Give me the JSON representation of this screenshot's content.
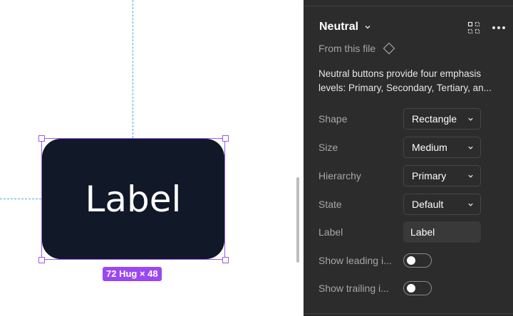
{
  "canvas": {
    "button_label": "Label",
    "size_badge": "72 Hug × 48"
  },
  "panel": {
    "component_name": "Neutral",
    "source_text": "From this file",
    "description_lines": [
      "Neutral buttons provide four emphasis",
      "levels: Primary, Secondary, Tertiary, an..."
    ],
    "properties": [
      {
        "label": "Shape",
        "type": "dropdown",
        "value": "Rectangle"
      },
      {
        "label": "Size",
        "type": "dropdown",
        "value": "Medium"
      },
      {
        "label": "Hierarchy",
        "type": "dropdown",
        "value": "Primary"
      },
      {
        "label": "State",
        "type": "dropdown",
        "value": "Default"
      },
      {
        "label": "Label",
        "type": "text",
        "value": "Label"
      },
      {
        "label": "Show leading i...",
        "type": "toggle",
        "on": false
      },
      {
        "label": "Show trailing i...",
        "type": "toggle",
        "on": false
      }
    ]
  },
  "icons": {
    "title_chevron": "chevron-down-icon",
    "instance_grid": "instance-grid-icon",
    "more": "more-options-icon",
    "source": "component-diamond-icon",
    "dropdown_chevron": "chevron-down-icon"
  },
  "colors": {
    "selection": "#9b59f5",
    "badge": "#9b47f2",
    "guide": "#4ea7e6",
    "button_fill": "#111827",
    "panel_bg": "#2c2c2c"
  }
}
